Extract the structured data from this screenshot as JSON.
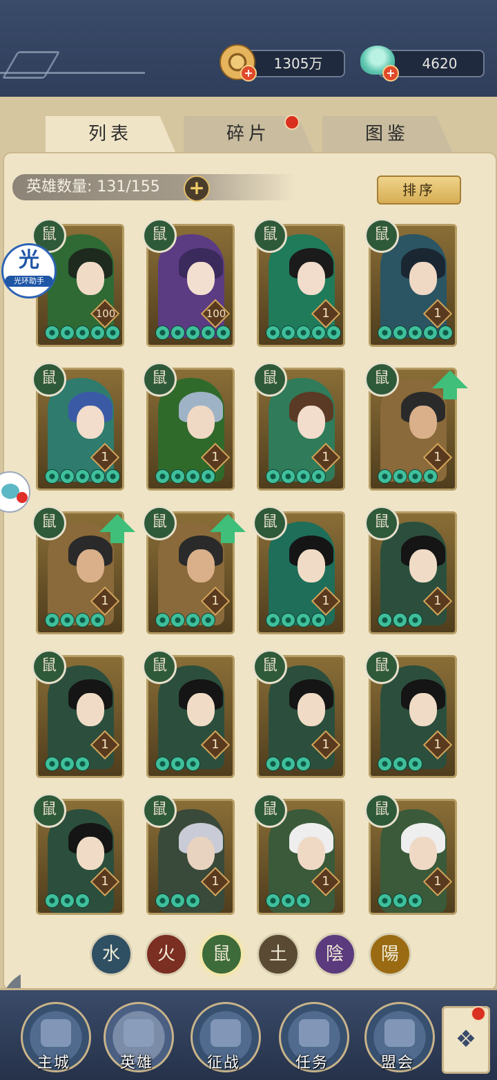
{
  "currency": {
    "coins": "1305万",
    "jade": "4620"
  },
  "tabs": [
    {
      "label": "列表",
      "active": true
    },
    {
      "label": "碎片",
      "has_notice": true
    },
    {
      "label": "图鉴"
    }
  ],
  "hero_count": "英雄数量: 131/155",
  "sort_label": "排序",
  "helper": {
    "icon_text": "光",
    "label": "光环助手"
  },
  "active_element": "鼠",
  "heroes": [
    {
      "element": "鼠",
      "level": "100",
      "stars": 5,
      "upgrade": false,
      "hair": "#1e2a1e",
      "robe": "#2f6a35",
      "skin": "#f0dcc6"
    },
    {
      "element": "鼠",
      "level": "100",
      "stars": 5,
      "upgrade": false,
      "hair": "#3b2a5c",
      "robe": "#5b3c83",
      "skin": "#f3dfcf"
    },
    {
      "element": "鼠",
      "level": "1",
      "stars": 5,
      "upgrade": false,
      "hair": "#1b1b1b",
      "robe": "#1f7b5a",
      "skin": "#f2dccb"
    },
    {
      "element": "鼠",
      "level": "1",
      "stars": 5,
      "upgrade": false,
      "hair": "#1a2733",
      "robe": "#2b5563",
      "skin": "#efd8c4"
    },
    {
      "element": "鼠",
      "level": "1",
      "stars": 5,
      "upgrade": false,
      "hair": "#3b5aa6",
      "robe": "#2f7b6d",
      "skin": "#f2dccb"
    },
    {
      "element": "鼠",
      "level": "1",
      "stars": 4,
      "upgrade": false,
      "hair": "#9fb3c6",
      "robe": "#2f6a2b",
      "skin": "#efd8c4"
    },
    {
      "element": "鼠",
      "level": "1",
      "stars": 4,
      "upgrade": false,
      "hair": "#5a3a24",
      "robe": "#2f7b5a",
      "skin": "#f2dccb"
    },
    {
      "element": "鼠",
      "level": "1",
      "stars": 4,
      "upgrade": true,
      "hair": "#2a2a2a",
      "robe": "#8a6a3a",
      "skin": "#d9b08a"
    },
    {
      "element": "鼠",
      "level": "1",
      "stars": 4,
      "upgrade": true,
      "hair": "#2a2a2a",
      "robe": "#8a6a3a",
      "skin": "#d9b08a"
    },
    {
      "element": "鼠",
      "level": "1",
      "stars": 4,
      "upgrade": true,
      "hair": "#2a2a2a",
      "robe": "#8a6a3a",
      "skin": "#d9b08a"
    },
    {
      "element": "鼠",
      "level": "1",
      "stars": 4,
      "upgrade": false,
      "hair": "#151515",
      "robe": "#1e6e59",
      "skin": "#f0dcc6"
    },
    {
      "element": "鼠",
      "level": "1",
      "stars": 3,
      "upgrade": false,
      "hair": "#151515",
      "robe": "#2c4f3d",
      "skin": "#f0dcc6"
    },
    {
      "element": "鼠",
      "level": "1",
      "stars": 3,
      "upgrade": false,
      "hair": "#151515",
      "robe": "#2c4f3d",
      "skin": "#f0dcc6"
    },
    {
      "element": "鼠",
      "level": "1",
      "stars": 3,
      "upgrade": false,
      "hair": "#151515",
      "robe": "#2c4f3d",
      "skin": "#f0dcc6"
    },
    {
      "element": "鼠",
      "level": "1",
      "stars": 3,
      "upgrade": false,
      "hair": "#151515",
      "robe": "#2c4f3d",
      "skin": "#f0dcc6"
    },
    {
      "element": "鼠",
      "level": "1",
      "stars": 3,
      "upgrade": false,
      "hair": "#151515",
      "robe": "#2c4f3d",
      "skin": "#f0dcc6"
    },
    {
      "element": "鼠",
      "level": "1",
      "stars": 3,
      "upgrade": false,
      "hair": "#151515",
      "robe": "#2c4f3d",
      "skin": "#f0dcc6"
    },
    {
      "element": "鼠",
      "level": "1",
      "stars": 3,
      "upgrade": false,
      "hair": "#c9cbd6",
      "robe": "#3a4a3a",
      "skin": "#e8d2c0"
    },
    {
      "element": "鼠",
      "level": "1",
      "stars": 3,
      "upgrade": false,
      "hair": "#eeeeee",
      "robe": "#3a5a3a",
      "skin": "#efd9c5"
    },
    {
      "element": "鼠",
      "level": "1",
      "stars": 3,
      "upgrade": false,
      "hair": "#eeeeee",
      "robe": "#3a5a3a",
      "skin": "#efd9c5"
    }
  ],
  "element_filters": [
    {
      "label": "水",
      "color": "#2f4f63"
    },
    {
      "label": "火",
      "color": "#7b2e22"
    },
    {
      "label": "鼠",
      "color": "#3e6b3a"
    },
    {
      "label": "土",
      "color": "#5a4a33"
    },
    {
      "label": "陰",
      "color": "#5b3a7d"
    },
    {
      "label": "陽",
      "color": "#9a6b12"
    }
  ],
  "bottom_nav": [
    {
      "label": "主城"
    },
    {
      "label": "英雄",
      "active": true
    },
    {
      "label": "征战"
    },
    {
      "label": "任务"
    },
    {
      "label": "盟会"
    }
  ],
  "extra_icon": "❖"
}
